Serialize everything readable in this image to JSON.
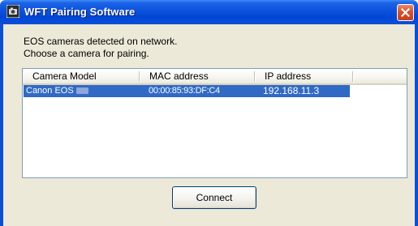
{
  "window": {
    "title": "WFT Pairing Software"
  },
  "message": {
    "line1": "EOS cameras detected on network.",
    "line2": "Choose a camera for pairing."
  },
  "camera_list": {
    "columns": [
      "Camera Model",
      "MAC address",
      "IP address"
    ],
    "rows": [
      {
        "model": "Canon EOS",
        "mac": "00:00:85:93:DF:C4",
        "ip": "192.168.11.3",
        "selected": true
      }
    ]
  },
  "buttons": {
    "connect_label": "Connect"
  },
  "colors": {
    "titlebar": "#0a52dc",
    "selection": "#316ac5",
    "dialog_face": "#ece9d8",
    "close_button": "#d9512b"
  },
  "icons": {
    "app": "camera-app-icon",
    "close": "close-icon"
  }
}
